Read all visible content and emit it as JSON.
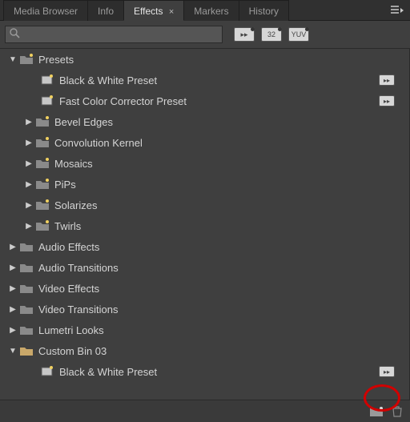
{
  "tabs": {
    "items": [
      {
        "label": "Media Browser",
        "active": false
      },
      {
        "label": "Info",
        "active": false
      },
      {
        "label": "Effects",
        "active": true,
        "closable": true
      },
      {
        "label": "Markers",
        "active": false
      },
      {
        "label": "History",
        "active": false
      }
    ]
  },
  "search": {
    "value": "",
    "placeholder": ""
  },
  "filter_badges": {
    "b0": "▸▸",
    "b1": "32",
    "b2": "YUV"
  },
  "tree": {
    "presets": {
      "label": "Presets",
      "open": true,
      "children": {
        "bw": "Black & White Preset",
        "fcc": "Fast Color Corrector Preset",
        "bevel": "Bevel Edges",
        "conv": "Convolution Kernel",
        "mosaics": "Mosaics",
        "pips": "PiPs",
        "solarizes": "Solarizes",
        "twirls": "Twirls"
      }
    },
    "audio_effects": "Audio Effects",
    "audio_transitions": "Audio Transitions",
    "video_effects": "Video Effects",
    "video_transitions": "Video Transitions",
    "lumetri": "Lumetri Looks",
    "custom_bin": {
      "label": "Custom Bin 03",
      "open": true,
      "children": {
        "bw2": "Black & White Preset"
      }
    }
  },
  "colors": {
    "folder_grey": "#8a8a8a",
    "folder_tan": "#c9a86a"
  }
}
